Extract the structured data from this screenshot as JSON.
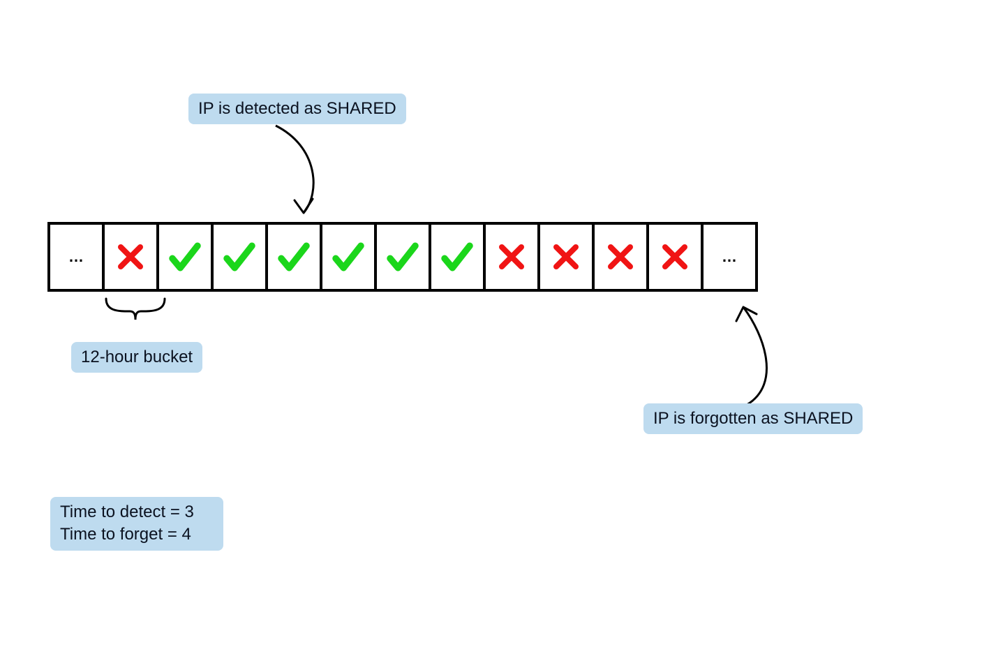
{
  "labels": {
    "detected": "IP is detected as SHARED",
    "bucket": "12-hour bucket",
    "forgotten": "IP is forgotten as SHARED",
    "detect_line": "Time to detect = 3",
    "forget_line": "Time to forget = 4"
  },
  "cells": [
    {
      "kind": "ellipsis"
    },
    {
      "kind": "x"
    },
    {
      "kind": "check"
    },
    {
      "kind": "check"
    },
    {
      "kind": "check"
    },
    {
      "kind": "check"
    },
    {
      "kind": "check"
    },
    {
      "kind": "check"
    },
    {
      "kind": "x"
    },
    {
      "kind": "x"
    },
    {
      "kind": "x"
    },
    {
      "kind": "x"
    },
    {
      "kind": "ellipsis"
    }
  ],
  "chart_data": {
    "type": "table",
    "title": "Shared IP detection timeline",
    "bucket_size_hours": 12,
    "time_to_detect_buckets": 3,
    "time_to_forget_buckets": 4,
    "sequence": [
      "...",
      "x",
      "check",
      "check",
      "check",
      "check",
      "check",
      "check",
      "x",
      "x",
      "x",
      "x",
      "..."
    ],
    "annotations": [
      {
        "text": "IP is detected as SHARED",
        "points_to_index": 4
      },
      {
        "text": "IP is forgotten as SHARED",
        "points_to_index": 12
      },
      {
        "text": "12-hour bucket",
        "points_to_index": 1
      }
    ]
  }
}
